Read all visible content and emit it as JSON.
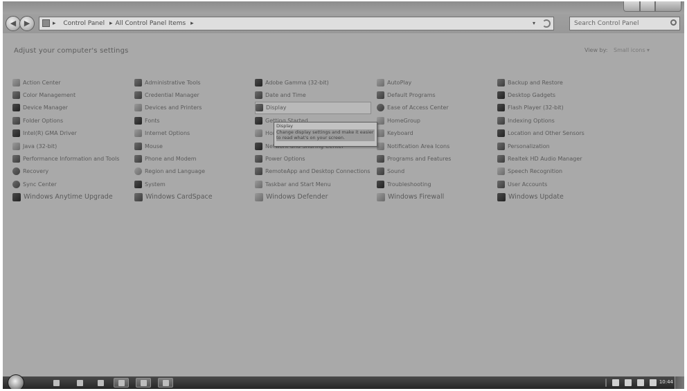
{
  "window": {
    "nav": {
      "back_glyph": "◀",
      "forward_glyph": "▶",
      "breadcrumb": [
        "Control Panel",
        "All Control Panel Items"
      ],
      "breadcrumb_separator": "▸",
      "dropdown_glyph": "▾",
      "search_placeholder": "Search Control Panel"
    }
  },
  "header": {
    "title": "Adjust your computer's settings",
    "view_by_label": "View by:",
    "view_by_value": "Small icons ▾"
  },
  "columns": [
    [
      "Action Center",
      "Color Management",
      "Device Manager",
      "Folder Options",
      "Intel(R) GMA Driver",
      "Java (32-bit)",
      "Performance Information and Tools",
      "Recovery",
      "Sync Center",
      "Windows Anytime Upgrade"
    ],
    [
      "Administrative Tools",
      "Credential Manager",
      "Devices and Printers",
      "Fonts",
      "Internet Options",
      "Mouse",
      "Phone and Modem",
      "Region and Language",
      "System",
      "Windows CardSpace"
    ],
    [
      "Adobe Gamma (32-bit)",
      "Date and Time",
      "Display",
      "Getting Started",
      "HomeGroup",
      "Network and Sharing Center",
      "Power Options",
      "RemoteApp and Desktop Connections",
      "Taskbar and Start Menu",
      "Windows Defender"
    ],
    [
      "AutoPlay",
      "Default Programs",
      "Ease of Access Center",
      "HomeGroup",
      "Keyboard",
      "Notification Area Icons",
      "Programs and Features",
      "Sound",
      "Troubleshooting",
      "Windows Firewall"
    ],
    [
      "Backup and Restore",
      "Desktop Gadgets",
      "Flash Player (32-bit)",
      "Indexing Options",
      "Location and Other Sensors",
      "Personalization",
      "Realtek HD Audio Manager",
      "Speech Recognition",
      "User Accounts",
      "Windows Update"
    ]
  ],
  "tooltip": {
    "line1": "Display",
    "line2": "Change display settings and make it easier",
    "line3": "to read what's on your screen."
  },
  "taskbar": {
    "clock": "10:44"
  }
}
